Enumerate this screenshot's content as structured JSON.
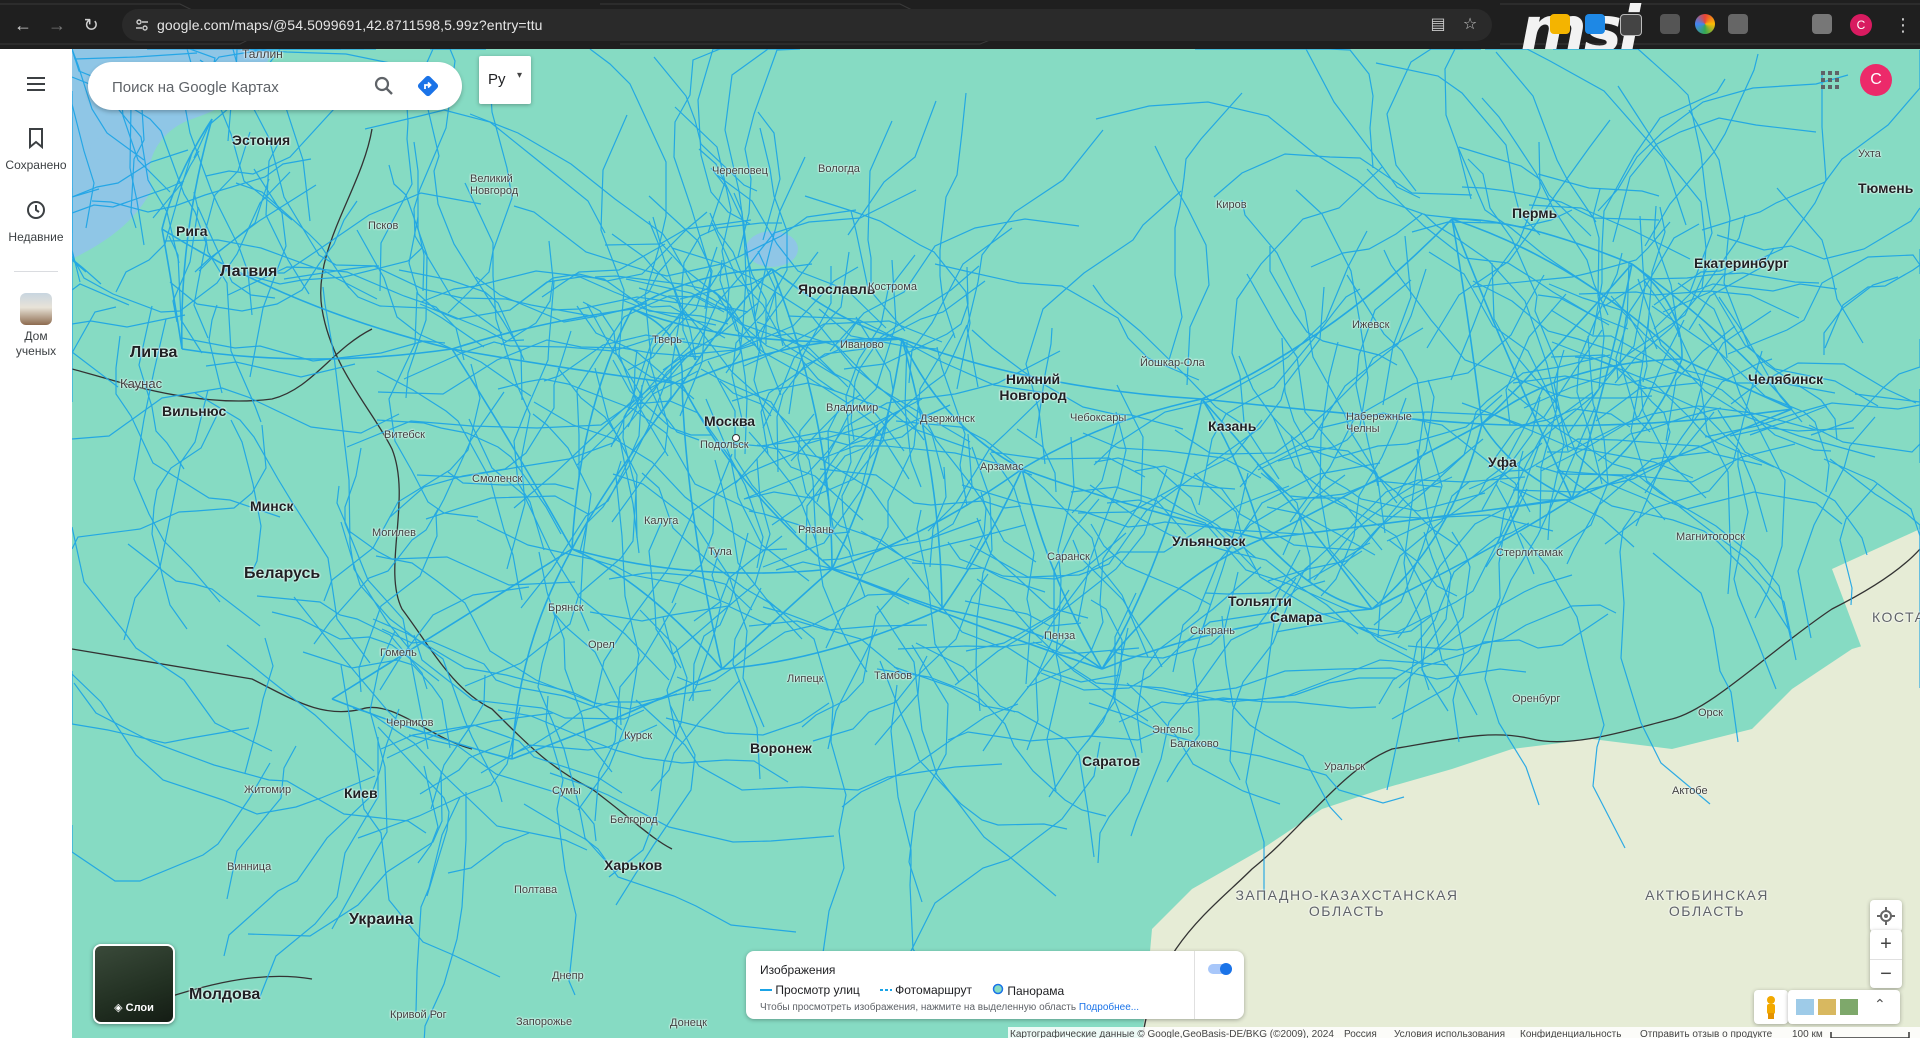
{
  "browser": {
    "url": "google.com/maps/@54.5099691,42.8711598,5.99z?entry=ttu",
    "profile_initial": "C",
    "brand": "msi"
  },
  "rail": {
    "items": [
      {
        "label": "Сохранено",
        "icon": "bookmark-icon"
      },
      {
        "label": "Недавние",
        "icon": "history-icon"
      },
      {
        "label": "Дом ученых",
        "icon": "place-thumbnail"
      }
    ]
  },
  "search": {
    "placeholder": "Поиск на Google Картах",
    "lang_button": "Ру"
  },
  "account": {
    "initial": "C"
  },
  "layers": {
    "label": "Слои"
  },
  "imagery": {
    "title": "Изображения",
    "legend": [
      "Просмотр улиц",
      "Фотомаршрут",
      "Панорама"
    ],
    "hint": "Чтобы просмотреть изображения, нажмите на выделенную область",
    "more_link": "Подробнее...",
    "toggle_on": true
  },
  "footer": {
    "attribution": "Картографические данные © Google,GeoBasis-DE/BKG (©2009), 2024",
    "country": "Россия",
    "terms": "Условия использования",
    "privacy": "Конфиденциальность",
    "feedback": "Отправить отзыв о продукте",
    "scale": "100 км"
  },
  "colors": {
    "map_green": "#86dbc3",
    "streetview_blue": "#1aa3e6",
    "steppe": "#e6ecd6",
    "accent": "#1a73e8"
  },
  "map": {
    "countries": [
      "Эстония",
      "Латвия",
      "Литва",
      "Беларусь",
      "Украина",
      "Молдова"
    ],
    "regions": [
      "ЗАПАДНО-КАЗАХСТАНСКАЯ ОБЛАСТЬ",
      "АКТЮБИНСКАЯ ОБЛАСТЬ",
      "КОСТА"
    ],
    "major_cities": [
      "Москва",
      "Нижний Новгород",
      "Казань",
      "Самара",
      "Уфа",
      "Пермь",
      "Екатеринбург",
      "Челябинск",
      "Воронеж",
      "Саратов",
      "Минск",
      "Киев",
      "Харьков",
      "Рига",
      "Вильнюс",
      "Ярославль",
      "Ульяновск",
      "Тольятти",
      "Тюмень",
      "Таллин",
      "Каунас"
    ],
    "towns": [
      "Вологда",
      "Череповец",
      "Тверь",
      "Владимир",
      "Иваново",
      "Кострома",
      "Рязань",
      "Тула",
      "Калуга",
      "Подольск",
      "Смоленск",
      "Брянск",
      "Орел",
      "Курск",
      "Липецк",
      "Тамбов",
      "Пенза",
      "Белгород",
      "Псков",
      "Великий Новгород",
      "Витебск",
      "Могилев",
      "Гомель",
      "Полтава",
      "Днепр",
      "Кривой Рог",
      "Запорожье",
      "Донецк",
      "Житомир",
      "Винница",
      "Чернигов",
      "Сумы",
      "Киров",
      "Ижевск",
      "Набережные Челны",
      "Оренбург",
      "Стерлитамак",
      "Магнитогорск",
      "Дзержинск",
      "Арзамас",
      "Саранск",
      "Сызрань",
      "Чебоксары",
      "Йошкар-Ола",
      "Энгельс",
      "Балаково",
      "Уральск",
      "Актобе",
      "Орск",
      "Ухта"
    ]
  }
}
